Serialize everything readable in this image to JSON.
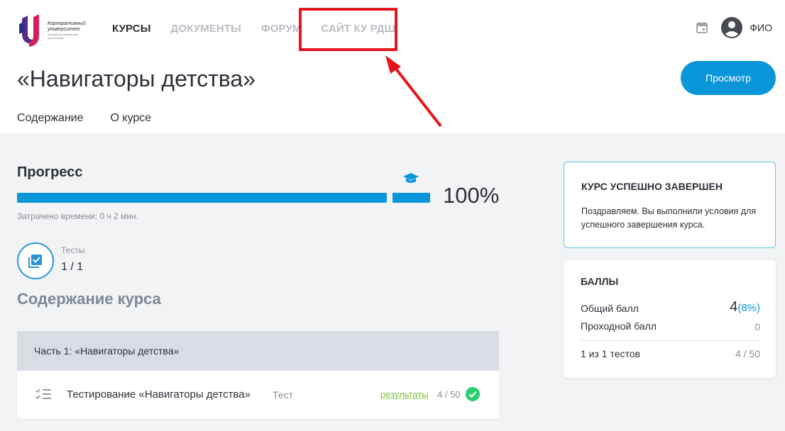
{
  "logo": {
    "line1": "Корпоративный",
    "line2": "университет",
    "line3": "Российского движения школьников"
  },
  "nav": {
    "items": [
      {
        "label": "КУРСЫ"
      },
      {
        "label": "ДОКУМЕНТЫ"
      },
      {
        "label": "ФОРУМ"
      },
      {
        "label": "САЙТ КУ РДШ"
      }
    ]
  },
  "header": {
    "user_name": "ФИО",
    "calendar_icon": "calendar-icon",
    "user_icon": "account-circle-icon"
  },
  "course": {
    "title": "«Навигаторы детства»",
    "view_button": "Просмотр"
  },
  "tabs": [
    {
      "label": "Содержание"
    },
    {
      "label": "О курсе"
    }
  ],
  "progress": {
    "title": "Прогресс",
    "fraction": 1.0,
    "percent_label": "100%",
    "time_spent": "Затрачено времени: 0 ч 2 мин."
  },
  "tests": {
    "label": "Тесты",
    "value": "1 / 1"
  },
  "content": {
    "title": "Содержание курса",
    "part_title": "Часть 1: «Навигаторы детства»",
    "lesson": {
      "name": "Тестирование «Навигаторы детства»",
      "type": "Тест",
      "results_link": "результаты",
      "score": "4 / 50"
    }
  },
  "complete_card": {
    "title": "КУРС УСПЕШНО ЗАВЕРШЕН",
    "text": "Поздравляем. Вы выполнили условия для успешного завершения курса."
  },
  "scores_card": {
    "title": "БАЛЛЫ",
    "total_label": "Общий балл",
    "total_value": "4",
    "total_percent": "(8%)",
    "pass_label": "Проходной балл",
    "pass_value": "0",
    "tests_label": "1 из 1 тестов",
    "tests_value": "4 / 50"
  },
  "colors": {
    "accent": "#0a97d9",
    "highlight": "#e3161b",
    "success": "#2ecc71"
  }
}
